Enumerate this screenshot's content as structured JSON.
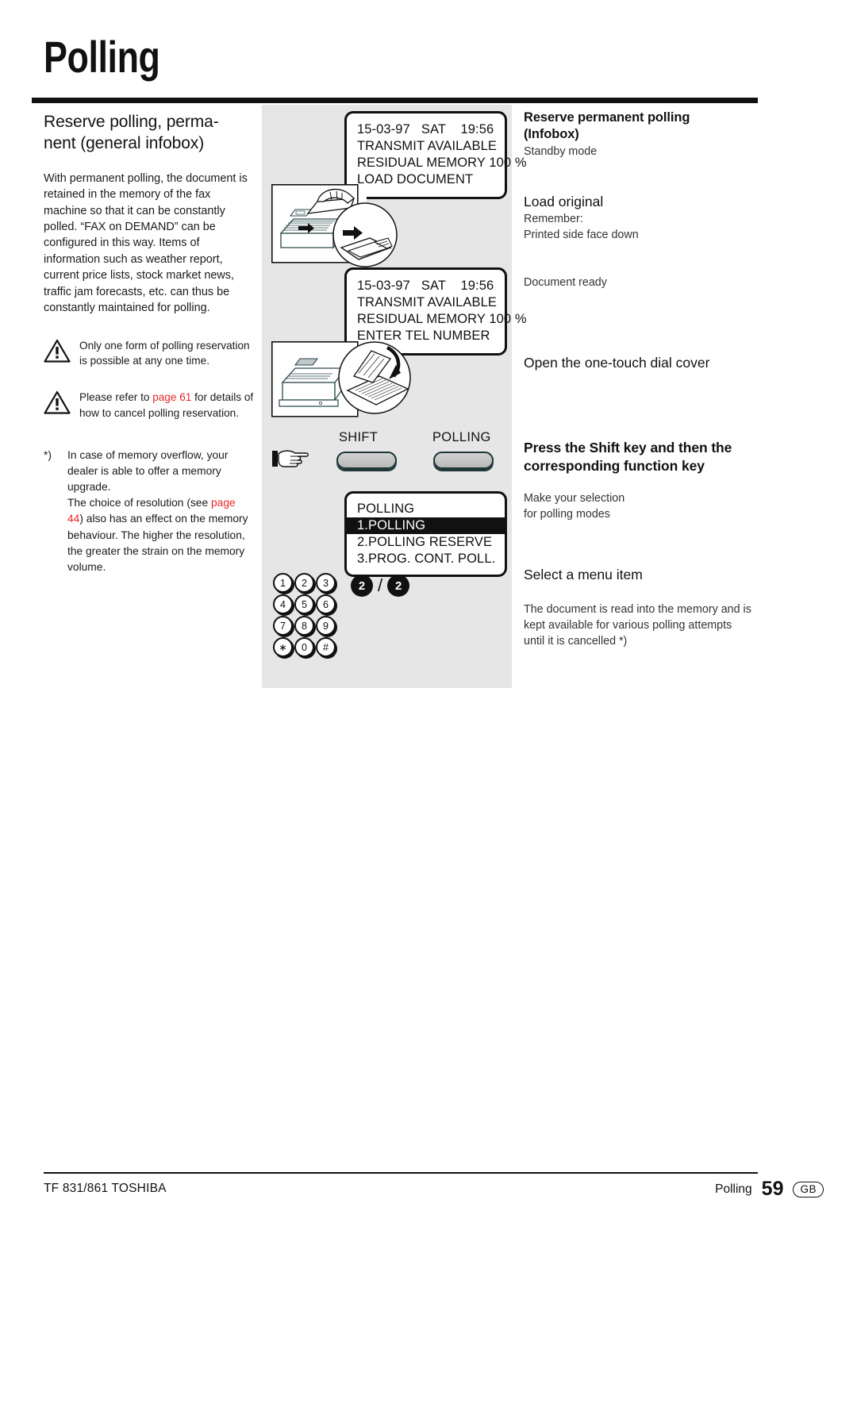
{
  "document": {
    "title": "Polling"
  },
  "left_column": {
    "heading": "Reserve polling, permanent (general infobox)",
    "intro": "With permanent polling, the document is retained in the memory of the fax machine so that it can be constantly polled. “FAX on DEMAND” can be configured in this way. Items of information such as weather report, current price lists, stock market news, traffic jam forecasts, etc. can thus be constantly maintained for polling.",
    "notes": [
      {
        "icon": "warning-triangle-icon",
        "text": "Only one form of polling reservation is possible at any one time."
      },
      {
        "icon": "warning-triangle-icon",
        "text_before": "Please refer to ",
        "link": "page 61",
        "text_after": " for details of how to cancel polling reservation."
      }
    ],
    "footnote": {
      "mark": "*)",
      "part1": "In case of memory overflow, your dealer is able to offer a memory upgrade.",
      "part2_before": "The choice of resolution (see ",
      "part2_link": "page 44",
      "part2_after": ") also has an effect on the memory behaviour. The higher the resolution, the greater the strain on the memory volume."
    }
  },
  "middle_column": {
    "lcd_1": {
      "name": "standby-display",
      "lines": [
        "15-03-97   SAT    19:56",
        "TRANSMIT AVAILABLE",
        "RESIDUAL MEMORY 100 %",
        "LOAD DOCUMENT"
      ]
    },
    "illustration_1": "load-document-illustration",
    "lcd_2": {
      "name": "document-ready-display",
      "lines": [
        "15-03-97   SAT    19:56",
        "TRANSMIT AVAILABLE",
        "RESIDUAL MEMORY 100 %",
        "ENTER TEL NUMBER"
      ]
    },
    "illustration_2": "open-one-touch-cover-illustration",
    "hand_icon": "pointing-hand-icon",
    "keys": [
      {
        "label": "SHIFT",
        "name": "shift-key"
      },
      {
        "label": "POLLING",
        "name": "polling-key"
      }
    ],
    "lcd_menu": {
      "name": "polling-menu-display",
      "title": "POLLING",
      "items": [
        {
          "text": "1.POLLING",
          "selected": true
        },
        {
          "text": "2.POLLING RESERVE",
          "selected": false
        },
        {
          "text": "3.PROG. CONT. POLL.",
          "selected": false
        }
      ]
    },
    "keypad": {
      "rows": [
        [
          "1",
          "2",
          "3"
        ],
        [
          "4",
          "5",
          "6"
        ],
        [
          "7",
          "8",
          "9"
        ],
        [
          "∗",
          "0",
          "#"
        ]
      ]
    },
    "selection_marks": {
      "first": "2",
      "separator": "/",
      "second": "2"
    }
  },
  "right_column": {
    "blocks": [
      {
        "heading_bold": "Reserve permanent polling (Infobox)",
        "sub": "Standby mode"
      },
      {
        "heading": "Load original",
        "sub": "Remember:\nPrinted side face down"
      },
      {
        "sub": "Document ready"
      },
      {
        "heading": "Open the one-touch dial cover"
      },
      {
        "heading": "Press the Shift key and then the corresponding function key",
        "sub": "Make your selection\nfor polling modes"
      },
      {
        "heading": "Select a menu item",
        "sub": "The document is read into the memory and is kept available for various polling attempts until it is cancelled *)"
      }
    ]
  },
  "footer": {
    "left": "TF 831/861 TOSHIBA",
    "section": "Polling",
    "page_number": "59",
    "language": "GB"
  },
  "colors": {
    "link_red": "#e8252a",
    "panel_grey": "#e6e6e6",
    "ink": "#111111"
  }
}
